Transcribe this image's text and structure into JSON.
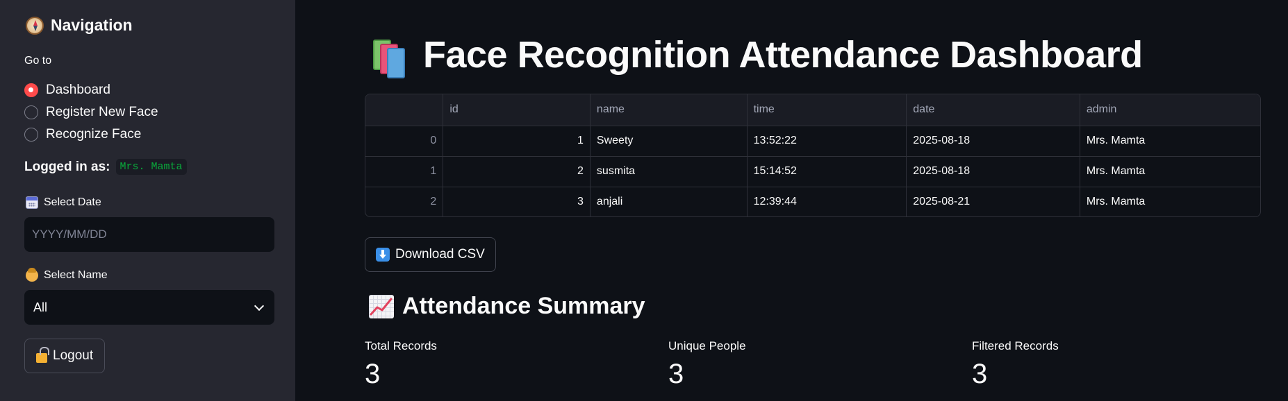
{
  "sidebar": {
    "title": "Navigation",
    "title_icon": "compass-icon",
    "goto_label": "Go to",
    "nav_options": [
      {
        "label": "Dashboard",
        "selected": true
      },
      {
        "label": "Register New Face",
        "selected": false
      },
      {
        "label": "Recognize Face",
        "selected": false
      }
    ],
    "logged_in_label": "Logged in as:",
    "logged_in_user": "Mrs. Mamta",
    "date_label": "Select Date",
    "date_icon": "calendar-icon",
    "date_placeholder": "YYYY/MM/DD",
    "name_label": "Select Name",
    "name_icon": "person-icon",
    "name_selected": "All",
    "logout_label": "Logout",
    "logout_icon": "unlock-icon"
  },
  "main": {
    "title": "Face Recognition Attendance Dashboard",
    "title_icon": "books-icon",
    "table": {
      "columns": [
        "",
        "id",
        "name",
        "time",
        "date",
        "admin"
      ],
      "rows": [
        [
          "0",
          "1",
          "Sweety",
          "13:52:22",
          "2025-08-18",
          "Mrs. Mamta"
        ],
        [
          "1",
          "2",
          "susmita",
          "15:14:52",
          "2025-08-18",
          "Mrs. Mamta"
        ],
        [
          "2",
          "3",
          "anjali",
          "12:39:44",
          "2025-08-21",
          "Mrs. Mamta"
        ]
      ]
    },
    "download_label": "Download CSV",
    "download_icon": "down-arrow-icon",
    "summary_title": "Attendance Summary",
    "summary_icon": "chart-increasing-icon",
    "metrics": [
      {
        "label": "Total Records",
        "value": "3"
      },
      {
        "label": "Unique People",
        "value": "3"
      },
      {
        "label": "Filtered Records",
        "value": "3"
      }
    ]
  },
  "colors": {
    "background": "#0e1117",
    "sidebar": "#262730",
    "accent": "#ff4b4b",
    "code_text": "#09ab3b"
  }
}
